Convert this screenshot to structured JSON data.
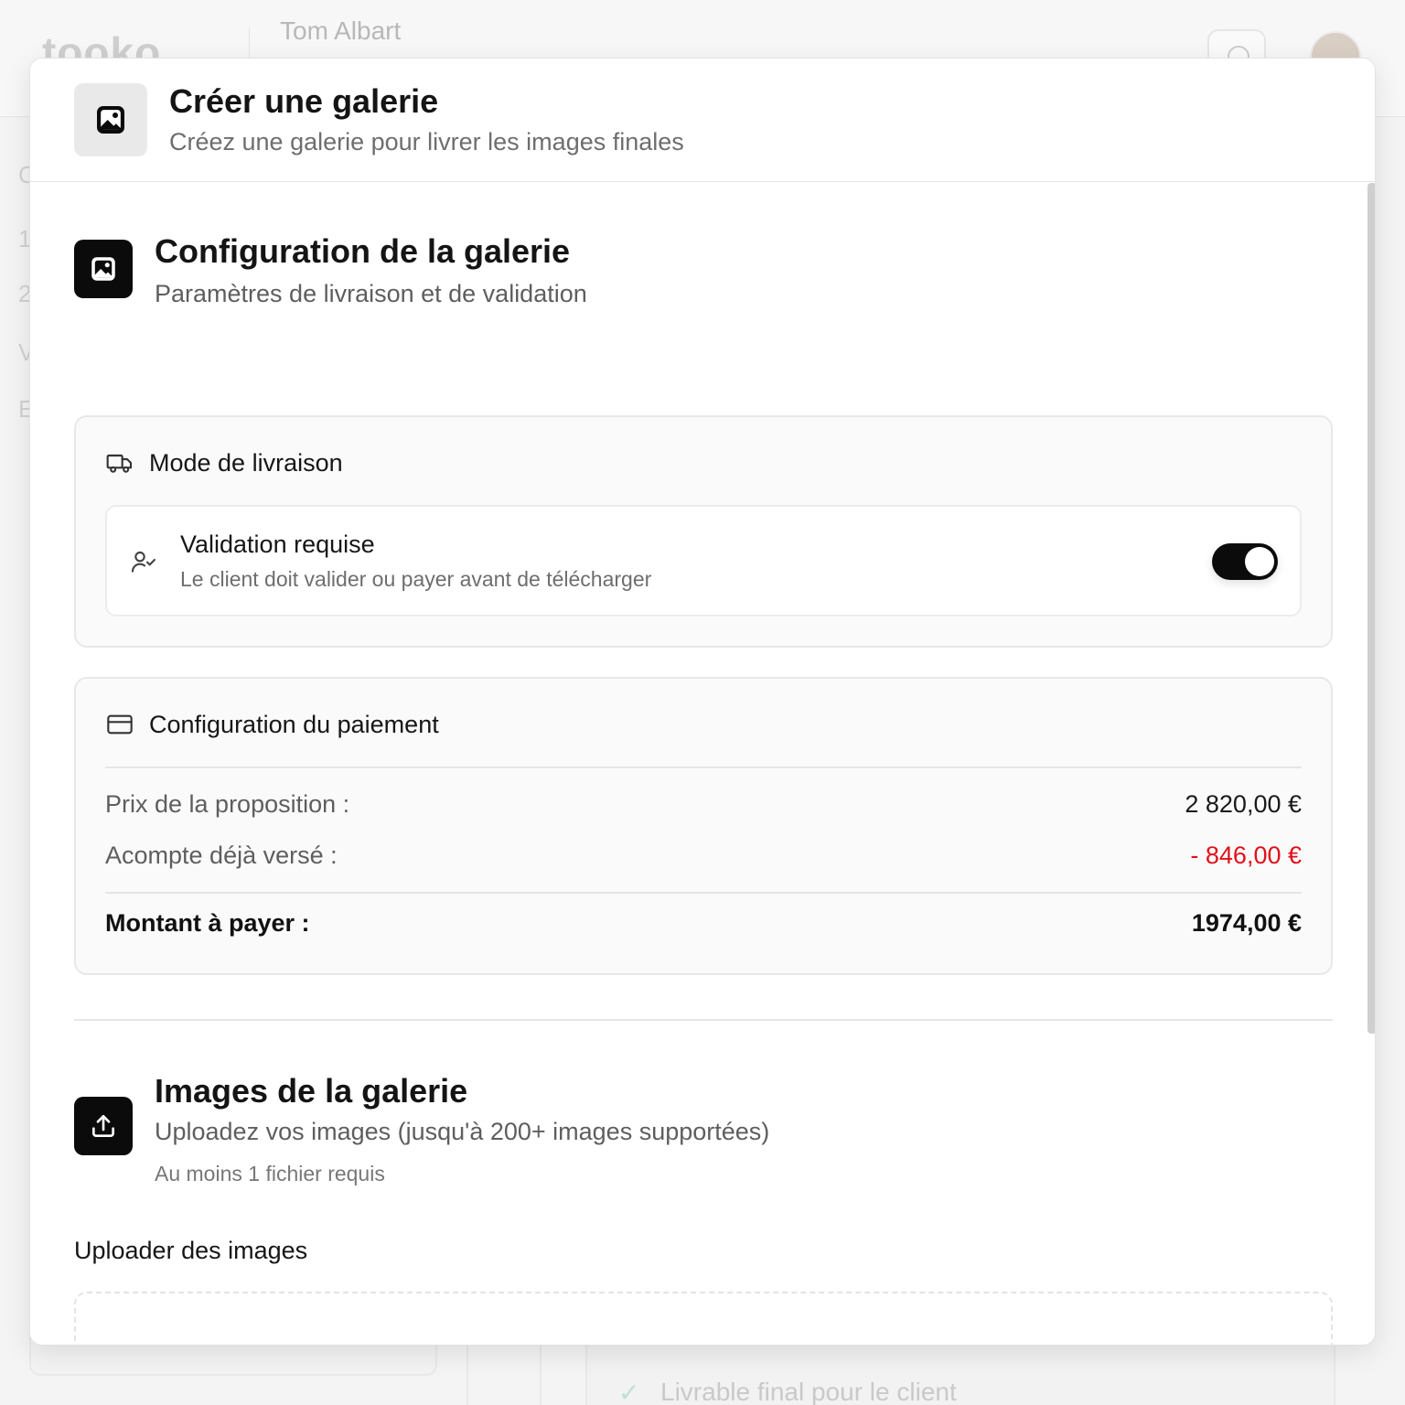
{
  "background": {
    "logo": "tooko",
    "user_name": "Tom Albart",
    "left_glyphs": [
      "C",
      "1",
      "2",
      "V",
      "E"
    ],
    "bottom_check_item": "Livrable final pour le client"
  },
  "modal": {
    "title": "Créer une galerie",
    "subtitle": "Créez une galerie pour livrer les images finales"
  },
  "gallery_config": {
    "title": "Configuration de la galerie",
    "subtitle": "Paramètres de livraison et de validation",
    "delivery": {
      "heading": "Mode de livraison",
      "validation_title": "Validation requise",
      "validation_description": "Le client doit valider ou payer avant de télécharger",
      "validation_enabled": true
    },
    "payment": {
      "heading": "Configuration du paiement",
      "proposal_price_label": "Prix de la proposition :",
      "proposal_price_value": "2 820,00 €",
      "deposit_label": "Acompte déjà versé :",
      "deposit_value": "- 846,00 €",
      "total_label": "Montant à payer :",
      "total_value": "1974,00 €"
    }
  },
  "gallery_images": {
    "title": "Images de la galerie",
    "subtitle": "Uploadez vos images (jusqu'à 200+ images supportées)",
    "requirement_note": "Au moins 1 fichier requis",
    "upload_label": "Uploader des images"
  },
  "colors": {
    "accent": "#0b0b0b",
    "negative": "#e0101a",
    "muted_text": "#6e6e6e"
  },
  "icons": {
    "modal_header": "image-icon",
    "gallery_config": "image-icon",
    "delivery": "truck-icon",
    "validation": "user-check-icon",
    "payment": "credit-card-icon",
    "gallery_images": "upload-icon"
  }
}
